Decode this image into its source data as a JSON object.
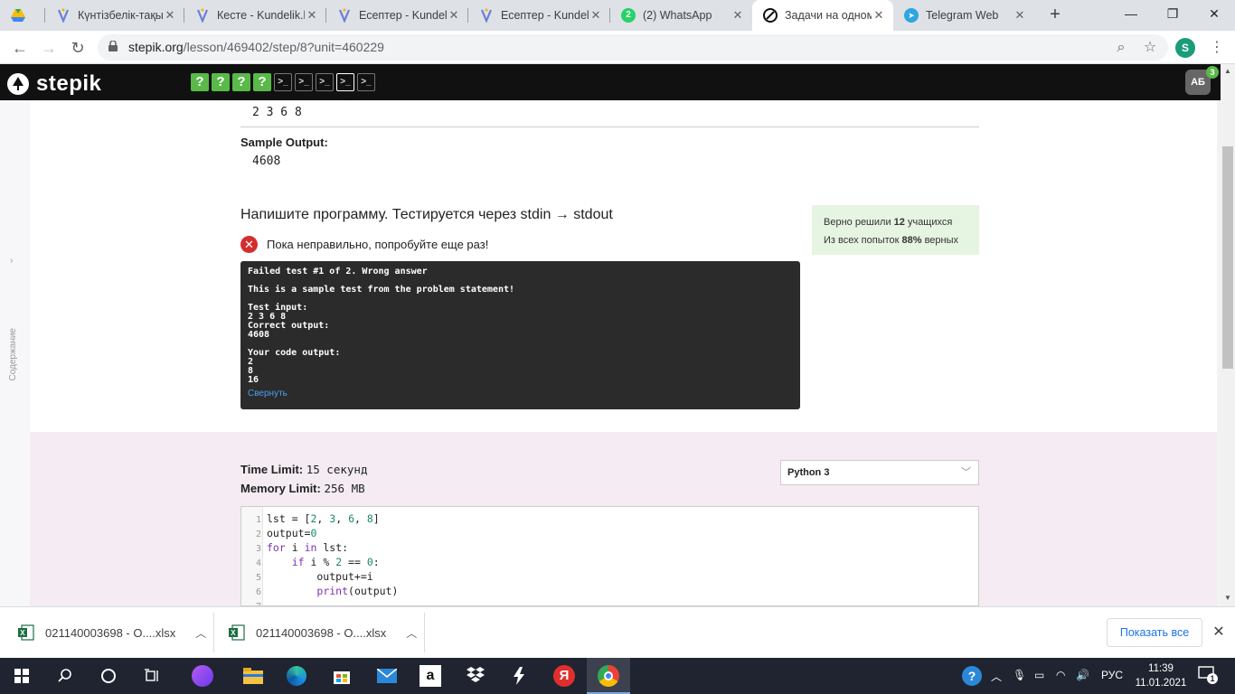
{
  "browser": {
    "tabs": [
      {
        "title": "",
        "icon": "google-drive-icon"
      },
      {
        "title": "Күнтізбелік-тақыр",
        "icon": "kundelik-icon"
      },
      {
        "title": "Кесте - Kundelik.k",
        "icon": "kundelik-icon"
      },
      {
        "title": "Есептер - Kundelik",
        "icon": "kundelik-icon"
      },
      {
        "title": "Есептер - Kundelik",
        "icon": "kundelik-icon"
      },
      {
        "title": "(2) WhatsApp",
        "icon": "whatsapp-icon",
        "badge": "2"
      },
      {
        "title": "Задачи на одном",
        "icon": "stepik-icon"
      },
      {
        "title": "Telegram Web",
        "icon": "telegram-icon"
      }
    ],
    "url_main": "stepik.org",
    "url_rest": "/lesson/469402/step/8?unit=460229",
    "profile_initial": "S"
  },
  "stepik": {
    "logo_text": "stepik",
    "steps": [
      "?",
      "?",
      "?",
      "?",
      ">_",
      ">_",
      ">_",
      ">_",
      ">_"
    ],
    "user_initials": "АБ",
    "user_badge": "3"
  },
  "problem": {
    "sample_input_value": "2 3 6 8",
    "sample_output_label": "Sample Output:",
    "sample_output_value": "4608",
    "title": "Напишите программу. Тестируется через stdin → stdout",
    "status_text": "Пока неправильно, попробуйте еще раз!",
    "stats": {
      "line1_prefix": "Верно решили ",
      "line1_count": "12",
      "line1_suffix": " учащихся",
      "line2_prefix": "Из всех попыток ",
      "line2_percent": "88%",
      "line2_suffix": " верных"
    },
    "sidebar_label": "Содержание"
  },
  "console": {
    "failed": "Failed test #1 of 2. Wrong answer",
    "sample_note": "This is a sample test from the problem statement!",
    "test_input_label": "Test input:",
    "test_input_value": "2 3 6 8",
    "correct_output_label": "Correct output:",
    "correct_output_value": "4608",
    "your_output_label": "Your code output:",
    "your_output_lines": [
      "2",
      "8",
      "16"
    ],
    "collapse_label": "Свернуть"
  },
  "limits": {
    "time_label": "Time Limit:",
    "time_value": "15 секунд",
    "memory_label": "Memory Limit:",
    "memory_value": "256 MB",
    "language": "Python 3"
  },
  "editor": {
    "lines": [
      {
        "n": "1",
        "code": "lst = [2, 3, 6, 8]"
      },
      {
        "n": "2",
        "code": "output=0"
      },
      {
        "n": "3",
        "code": "for i in lst:"
      },
      {
        "n": "4",
        "code": "    if i % 2 == 0:"
      },
      {
        "n": "5",
        "code": "        output+=i"
      },
      {
        "n": "6",
        "code": "        print(output)"
      },
      {
        "n": "7",
        "code": ""
      }
    ]
  },
  "downloads": {
    "items": [
      {
        "name": "021140003698 - O....xlsx"
      },
      {
        "name": "021140003698 - O....xlsx"
      }
    ],
    "show_all": "Показать все"
  },
  "taskbar": {
    "lang": "РУС",
    "time": "11:39",
    "date": "11.01.2021",
    "notification_count": "1"
  },
  "colors": {
    "stepik_green": "#59b949",
    "error_red": "#d32f2f",
    "stats_bg": "#e6f4e2",
    "console_bg": "#2b2b2b",
    "link_blue": "#4aa0f0"
  }
}
